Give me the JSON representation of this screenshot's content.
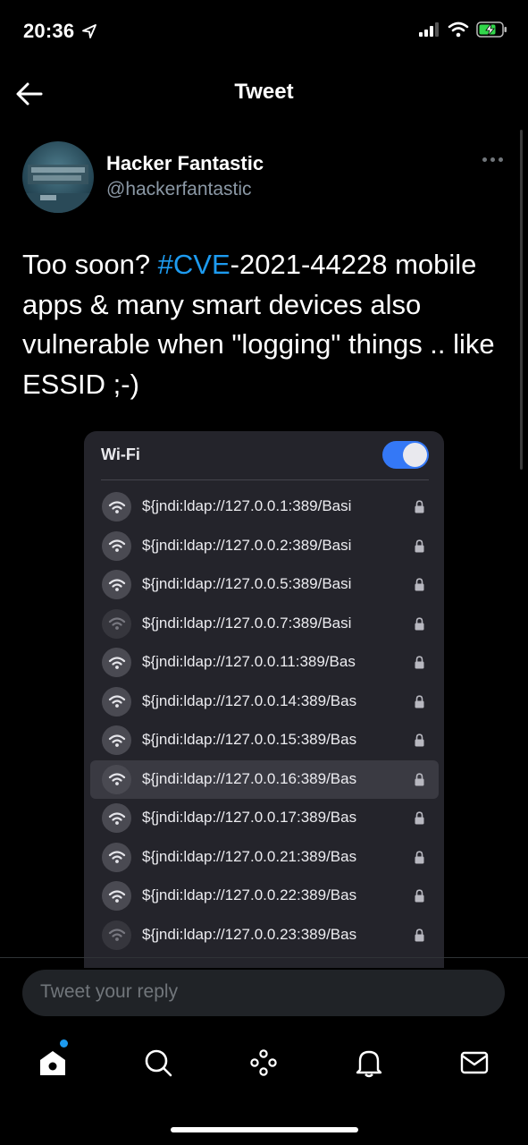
{
  "status_bar": {
    "time": "20:36"
  },
  "header": {
    "title": "Tweet"
  },
  "tweet": {
    "author_name": "Hacker Fantastic",
    "author_handle": "@hackerfantastic",
    "text_before": "Too soon? ",
    "hashtag": "#CVE",
    "text_after": "-2021-44228 mobile apps & many smart devices also vulnerable when \"logging\" things .. like ESSID ;-)"
  },
  "media": {
    "wifi_title": "Wi-Fi",
    "networks": [
      {
        "name": "${jndi:ldap://127.0.0.1:389/Basi"
      },
      {
        "name": "${jndi:ldap://127.0.0.2:389/Basi"
      },
      {
        "name": "${jndi:ldap://127.0.0.5:389/Basi"
      },
      {
        "name": "${jndi:ldap://127.0.0.7:389/Basi"
      },
      {
        "name": "${jndi:ldap://127.0.0.11:389/Bas"
      },
      {
        "name": "${jndi:ldap://127.0.0.14:389/Bas"
      },
      {
        "name": "${jndi:ldap://127.0.0.15:389/Bas"
      },
      {
        "name": "${jndi:ldap://127.0.0.16:389/Bas"
      },
      {
        "name": "${jndi:ldap://127.0.0.17:389/Bas"
      },
      {
        "name": "${jndi:ldap://127.0.0.21:389/Bas"
      },
      {
        "name": "${jndi:ldap://127.0.0.22:389/Bas"
      },
      {
        "name": "${jndi:ldap://127.0.0.23:389/Bas"
      }
    ]
  },
  "reply": {
    "placeholder": "Tweet your reply"
  },
  "tabs": [
    "home-icon",
    "search-icon",
    "spaces-icon",
    "notifications-icon",
    "messages-icon"
  ],
  "colors": {
    "link": "#1d9bf0",
    "toggle_on": "#3478f6",
    "background": "#000000"
  }
}
